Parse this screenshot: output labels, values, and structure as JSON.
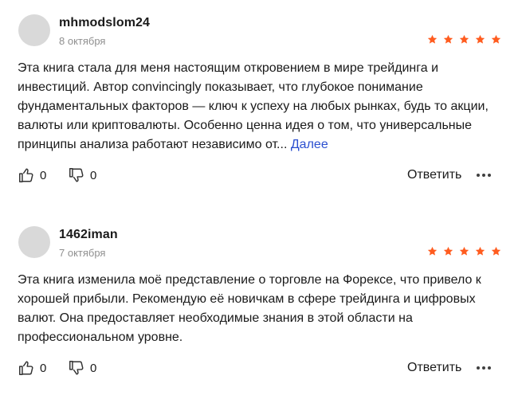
{
  "reviews": [
    {
      "username": "mhmodslom24",
      "date": "8 октября",
      "rating": 5,
      "text": "Эта книга стала для меня настоящим откровением в мире трейдинга и инвестиций. Автор convincingly показывает, что глубокое понимание фундаментальных факторов — ключ к успеху на любых рынках, будь то акции, валюты или криптовалюты. Особенно ценна идея о том, что универсальные принципы анализа работают независимо от...",
      "more_label": "Далее",
      "likes": "0",
      "dislikes": "0",
      "reply_label": "Ответить"
    },
    {
      "username": "1462iman",
      "date": "7 октября",
      "rating": 5,
      "text": "Эта книга изменила моё представление о торговле на Форексе, что привело к хорошей прибыли. Рекомендую её новичкам в сфере трейдинга и цифровых валют. Она предоставляет необходимые знания в этой области на профессиональном уровне.",
      "likes": "0",
      "dislikes": "0",
      "reply_label": "Ответить"
    }
  ],
  "colors": {
    "star": "#ff5c1f",
    "link": "#2b4fd0",
    "avatar": "#d9d9d9",
    "date": "#8f8f8f"
  },
  "icons": [
    "thumbs-up-icon",
    "thumbs-down-icon",
    "star-icon",
    "more-dots-icon"
  ]
}
